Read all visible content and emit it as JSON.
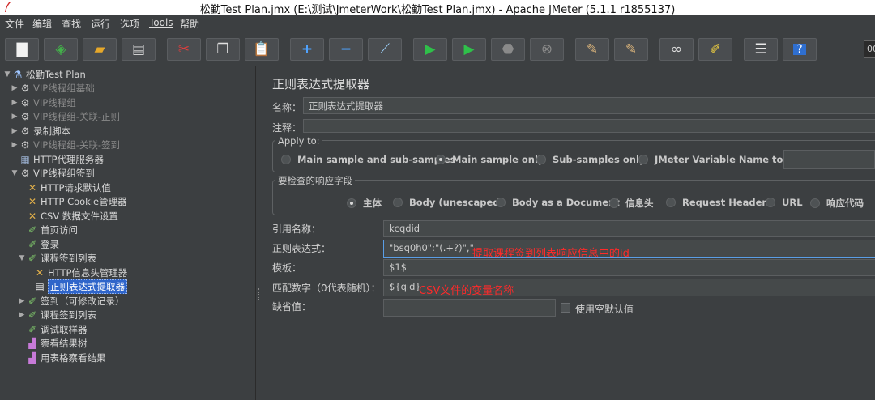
{
  "window": {
    "title": "松勤Test Plan.jmx (E:\\测试\\JmeterWork\\松勤Test Plan.jmx) - Apache JMeter (5.1.1 r1855137)"
  },
  "menu": [
    "文件",
    "编辑",
    "查找",
    "运行",
    "选项",
    "Tools",
    "帮助"
  ],
  "toolbar": {
    "buttons": [
      {
        "name": "new-button",
        "icon": "new-file-icon"
      },
      {
        "name": "templates-button",
        "icon": "templates-icon"
      },
      {
        "name": "open-button",
        "icon": "folder-icon"
      },
      {
        "name": "save-button",
        "icon": "floppy-icon"
      },
      {
        "name": "cut-button",
        "icon": "scissors-icon"
      },
      {
        "name": "copy-button",
        "icon": "copy-icon"
      },
      {
        "name": "paste-button",
        "icon": "clipboard-icon"
      },
      {
        "name": "expand-button",
        "icon": "plus-icon"
      },
      {
        "name": "collapse-button",
        "icon": "minus-icon"
      },
      {
        "name": "toggle-button",
        "icon": "wand-icon"
      },
      {
        "name": "start-button",
        "icon": "play-icon"
      },
      {
        "name": "start-no-pause-button",
        "icon": "play-timer-icon"
      },
      {
        "name": "stop-button",
        "icon": "stop-icon"
      },
      {
        "name": "shutdown-button",
        "icon": "shutdown-icon"
      },
      {
        "name": "clear-button",
        "icon": "broom-icon"
      },
      {
        "name": "clear-all-button",
        "icon": "broom-all-icon"
      },
      {
        "name": "search-button",
        "icon": "binoculars-icon"
      },
      {
        "name": "reset-search-button",
        "icon": "eraser-icon"
      },
      {
        "name": "function-helper-button",
        "icon": "list-icon"
      },
      {
        "name": "help-button",
        "icon": "help-icon"
      }
    ],
    "counter": "00"
  },
  "tree": {
    "items": [
      {
        "label": "松勤Test Plan",
        "icon": "flask-icon",
        "arrow": "▼",
        "indent": 0,
        "disabled": false
      },
      {
        "label": "VIP线程组基础",
        "icon": "gear-icon",
        "arrow": "▶",
        "indent": 1,
        "disabled": true
      },
      {
        "label": "VIP线程组",
        "icon": "gear-icon",
        "arrow": "▶",
        "indent": 1,
        "disabled": true
      },
      {
        "label": "VIP线程组-关联-正则",
        "icon": "gear-icon",
        "arrow": "▶",
        "indent": 1,
        "disabled": true
      },
      {
        "label": "录制脚本",
        "icon": "gear-icon",
        "arrow": "▶",
        "indent": 1,
        "disabled": false
      },
      {
        "label": "VIP线程组-关联-签到",
        "icon": "gear-icon",
        "arrow": "▶",
        "indent": 1,
        "disabled": true
      },
      {
        "label": "HTTP代理服务器",
        "icon": "proxy-icon",
        "arrow": "",
        "indent": 1,
        "disabled": false
      },
      {
        "label": "VIP线程组签到",
        "icon": "gear-icon",
        "arrow": "▼",
        "indent": 1,
        "disabled": false
      },
      {
        "label": "HTTP请求默认值",
        "icon": "wrench-icon",
        "arrow": "",
        "indent": 2,
        "disabled": false
      },
      {
        "label": "HTTP Cookie管理器",
        "icon": "wrench-icon",
        "arrow": "",
        "indent": 2,
        "disabled": false
      },
      {
        "label": "CSV 数据文件设置",
        "icon": "wrench-icon",
        "arrow": "",
        "indent": 2,
        "disabled": false
      },
      {
        "label": "首页访问",
        "icon": "pen-icon",
        "arrow": "",
        "indent": 2,
        "disabled": false
      },
      {
        "label": "登录",
        "icon": "pen-icon",
        "arrow": "",
        "indent": 2,
        "disabled": false
      },
      {
        "label": "课程签到列表",
        "icon": "pen-icon",
        "arrow": "▼",
        "indent": 2,
        "disabled": false
      },
      {
        "label": "HTTP信息头管理器",
        "icon": "wrench-icon",
        "arrow": "",
        "indent": 3,
        "disabled": false
      },
      {
        "label": "正则表达式提取器",
        "icon": "page-icon",
        "arrow": "",
        "indent": 3,
        "disabled": false,
        "selected": true
      },
      {
        "label": "签到（可修改记录）",
        "icon": "pen-icon",
        "arrow": "▶",
        "indent": 2,
        "disabled": false
      },
      {
        "label": "课程签到列表",
        "icon": "pen-icon",
        "arrow": "▶",
        "indent": 2,
        "disabled": false
      },
      {
        "label": "调试取样器",
        "icon": "pen-icon",
        "arrow": "",
        "indent": 2,
        "disabled": false
      },
      {
        "label": "察看结果树",
        "icon": "chart-icon",
        "arrow": "",
        "indent": 2,
        "disabled": false
      },
      {
        "label": "用表格察看结果",
        "icon": "chart-icon",
        "arrow": "",
        "indent": 2,
        "disabled": false
      }
    ]
  },
  "editor": {
    "title": "正则表达式提取器",
    "name_label": "名称：",
    "name_value": "正则表达式提取器",
    "comment_label": "注释：",
    "comment_value": "",
    "apply_to": {
      "legend": "Apply to:",
      "options": [
        "Main sample and sub-samples",
        "Main sample only",
        "Sub-samples only",
        "JMeter Variable Name to use"
      ],
      "selected": 1
    },
    "field_to_check": {
      "legend": "要检查的响应字段",
      "options": [
        "主体",
        "Body (unescaped)",
        "Body as a Document",
        "信息头",
        "Request Headers",
        "URL",
        "响应代码"
      ],
      "selected": 0
    },
    "ref_name_label": "引用名称：",
    "ref_name_value": "kcqdid",
    "regex_label": "正则表达式：",
    "regex_value": "\"bsq0h0\":\"(.+?)\",\"",
    "regex_annotation": "提取课程签到列表响应信息中的id",
    "template_label": "模板：",
    "template_value": "$1$",
    "match_no_label": "匹配数字（0代表随机）：",
    "match_no_value": "${qid}",
    "match_no_annotation": "CSV文件的变量名称",
    "default_label": "缺省值：",
    "default_value": "",
    "use_empty_label": "使用空默认值"
  }
}
